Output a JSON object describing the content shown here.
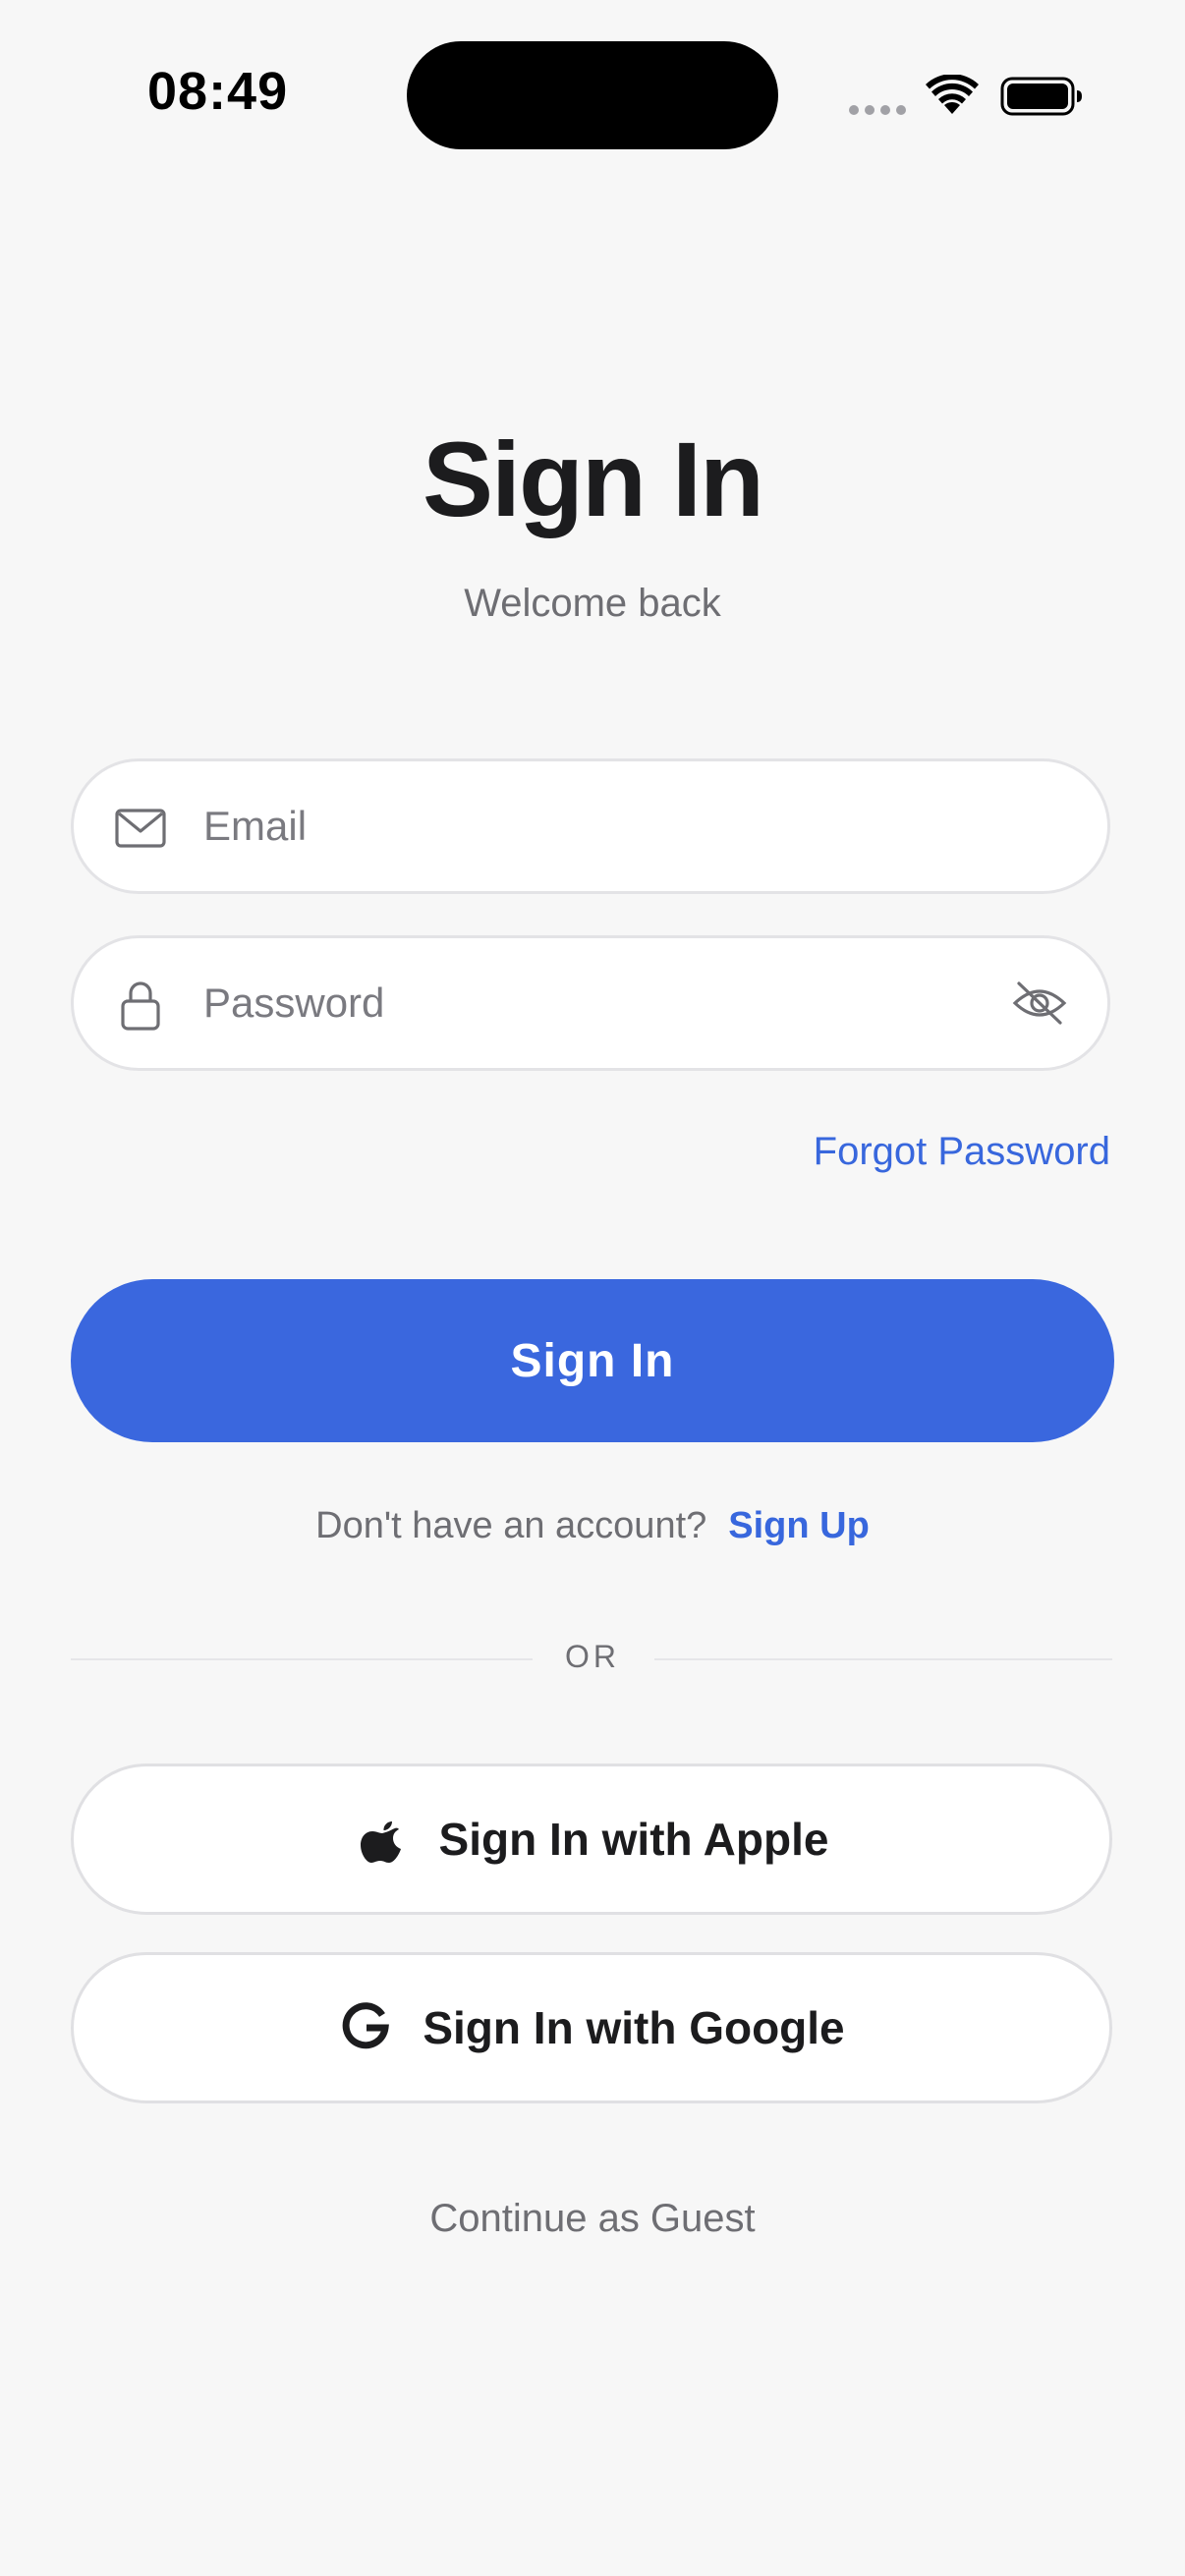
{
  "status_bar": {
    "time": "08:49"
  },
  "header": {
    "title": "Sign In",
    "subtitle": "Welcome back"
  },
  "form": {
    "email": {
      "placeholder": "Email",
      "value": "",
      "icon": "envelope-icon"
    },
    "password": {
      "placeholder": "Password",
      "value": "",
      "icon": "lock-icon",
      "toggle_icon": "eye-slash-icon"
    },
    "forgot_password_label": "Forgot Password",
    "submit_label": "Sign In"
  },
  "signup": {
    "prompt": "Don't have an account?",
    "link_label": "Sign Up"
  },
  "divider": {
    "label": "OR"
  },
  "social": {
    "apple_label": "Sign In with Apple",
    "apple_icon": "apple-logo-icon",
    "google_label": "Sign In with Google",
    "google_icon": "google-logo-icon"
  },
  "guest": {
    "label": "Continue as Guest"
  },
  "colors": {
    "accent": "#3a67de",
    "link": "#3867dd",
    "background": "#f7f7f7",
    "text_primary": "#1c1c1e",
    "text_secondary": "#6e6e73"
  }
}
